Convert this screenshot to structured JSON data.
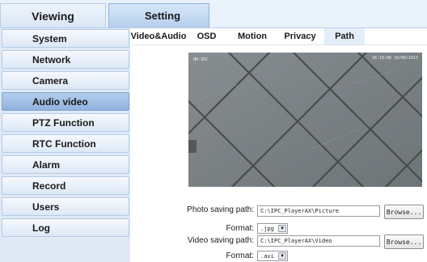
{
  "top_tabs": {
    "viewing": "Viewing",
    "setting": "Setting"
  },
  "sidebar": {
    "items": [
      {
        "label": "System"
      },
      {
        "label": "Network"
      },
      {
        "label": "Camera"
      },
      {
        "label": "Audio video",
        "active": true
      },
      {
        "label": "PTZ Function"
      },
      {
        "label": "RTC Function"
      },
      {
        "label": "Alarm"
      },
      {
        "label": "Record"
      },
      {
        "label": "Users"
      },
      {
        "label": "Log"
      }
    ]
  },
  "sub_tabs": {
    "items": [
      {
        "label": "Video&Audio"
      },
      {
        "label": "OSD"
      },
      {
        "label": "Motion"
      },
      {
        "label": "Privacy"
      },
      {
        "label": "Path",
        "active": true
      }
    ]
  },
  "video": {
    "osd_name": "HD-IPC",
    "osd_time": "10:19:08 10/09/2013"
  },
  "form": {
    "photo_path_label": "Photo saving path:",
    "photo_path_value": "C:\\IPC_PlayerAX\\Picture",
    "photo_format_label": "Format:",
    "photo_format_value": ".jpg",
    "video_path_label": "Video saving path:",
    "video_path_value": "C:\\IPC_PlayerAX\\Video",
    "video_format_label": "Format:",
    "video_format_value": ".avi",
    "browse_label": "Browse..."
  },
  "colors": {
    "active_tab": "#b6cfed",
    "active_sidebar": "#8fb2de",
    "sidebar_bg": "#dfe9f6"
  }
}
